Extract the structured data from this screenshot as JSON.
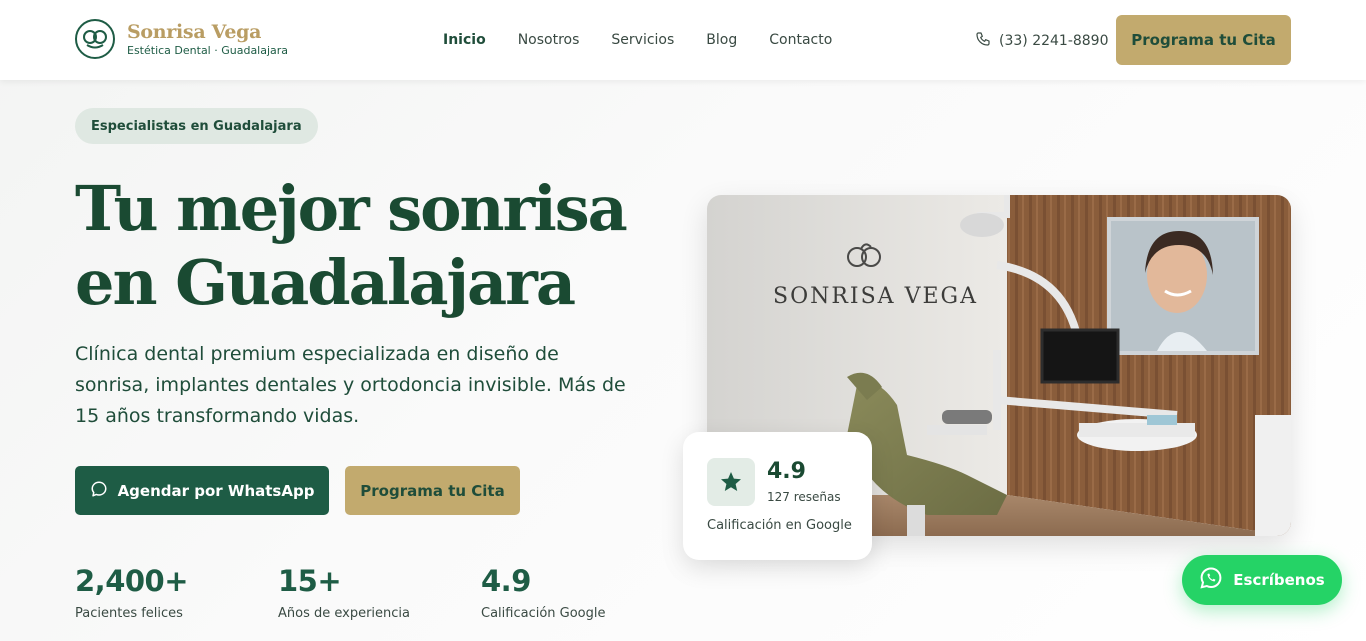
{
  "brand": {
    "name": "Sonrisa Vega",
    "subtitle": "Estética Dental · Guadalajara"
  },
  "nav": {
    "items": [
      {
        "label": "Inicio",
        "active": true
      },
      {
        "label": "Nosotros",
        "active": false
      },
      {
        "label": "Servicios",
        "active": false
      },
      {
        "label": "Blog",
        "active": false
      },
      {
        "label": "Contacto",
        "active": false
      }
    ]
  },
  "header": {
    "phone": "(33) 2241-8890",
    "cta": "Programa tu Cita"
  },
  "hero": {
    "badge": "Especialistas en Guadalajara",
    "title_line1": "Tu mejor sonrisa",
    "title_line2": "en Guadalajara",
    "description": "Clínica dental premium especializada en diseño de sonrisa, implantes dentales y ortodoncia invisible. Más de 15 años transformando vidas.",
    "btn_whatsapp": "Agendar por WhatsApp",
    "btn_cita": "Programa tu Cita"
  },
  "stats": [
    {
      "value": "2,400+",
      "label": "Pacientes felices"
    },
    {
      "value": "15+",
      "label": "Años de experiencia"
    },
    {
      "value": "4.9",
      "label": "Calificación Google"
    }
  ],
  "image": {
    "wall_sign": "SONRISA VEGA"
  },
  "rating_card": {
    "value": "4.9",
    "reviews": "127 reseñas",
    "source": "Calificación en Google"
  },
  "float_whatsapp": {
    "label": "Escríbenos"
  },
  "colors": {
    "primary_green": "#1e5c45",
    "gold": "#c2aa6e",
    "whatsapp_green": "#25d366"
  }
}
